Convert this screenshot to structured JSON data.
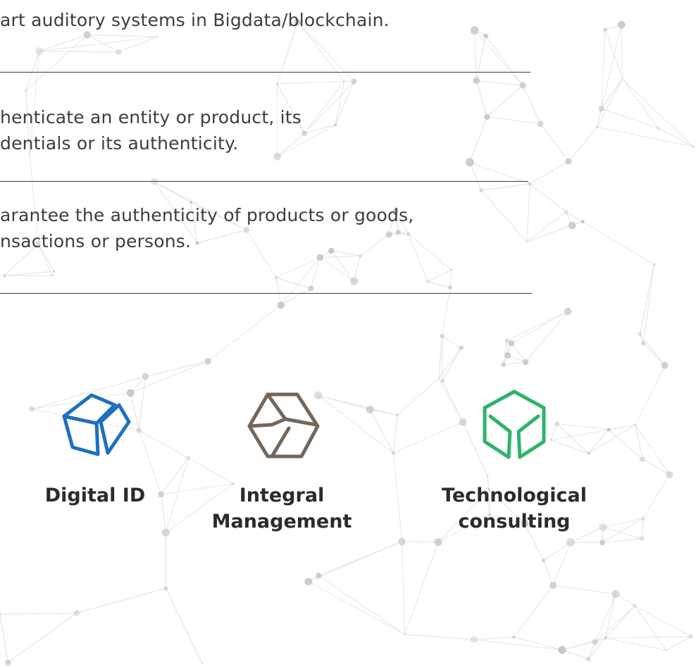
{
  "content": {
    "line_1": "art auditory systems in Bigdata/blockchain.",
    "line_2a": "henticate an entity or product, its",
    "line_2b": "dentials or its authenticity.",
    "line_3a": "arantee the authenticity of products or goods,",
    "line_3b": "nsactions or persons."
  },
  "services": [
    {
      "label_1": "Digital ID",
      "label_2": "",
      "icon": "cube-icon",
      "color": "#1f70bf"
    },
    {
      "label_1": "Integral",
      "label_2": "Management",
      "icon": "hexagon-cube-icon",
      "color": "#75665a"
    },
    {
      "label_1": "Technological",
      "label_2": "consulting",
      "icon": "open-cube-icon",
      "color": "#2fb36a"
    }
  ],
  "colors": {
    "text": "#3d3d3d",
    "rule": "#3b3b3b",
    "network_node": "#c8c8c8",
    "network_line": "#e6e6e6"
  }
}
